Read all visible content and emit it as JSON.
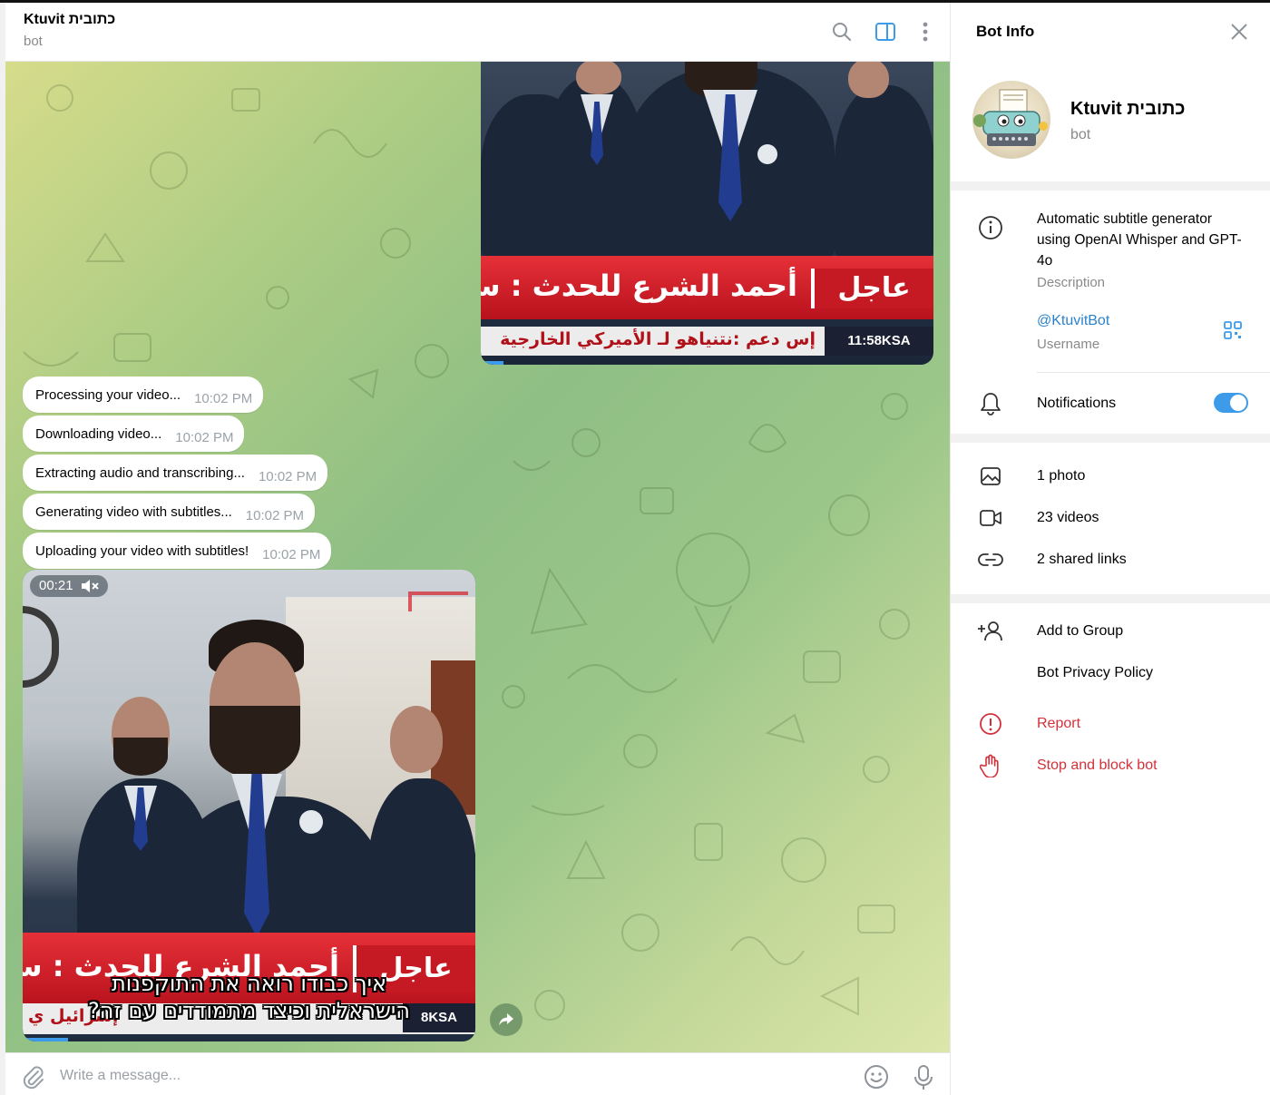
{
  "chat": {
    "title": "Ktuvit כתובית",
    "subtitle": "bot",
    "messages": [
      {
        "text": "Processing your video...",
        "time": "10:02 PM"
      },
      {
        "text": "Downloading video...",
        "time": "10:02 PM"
      },
      {
        "text": "Extracting audio and transcribing...",
        "time": "10:02 PM"
      },
      {
        "text": "Generating video with subtitles...",
        "time": "10:02 PM"
      },
      {
        "text": "Uploading your video with subtitles!",
        "time": "10:02 PM"
      }
    ],
    "video_top": {
      "banner_text": "أحمد الشرع للحدث : سوريا",
      "breaking_label": "عاجل",
      "ticker_text": "إس دعم :نتنياهو لـ الأميركي الخارجية",
      "clock": "11:58KSA",
      "progress": 0.05
    },
    "video_main": {
      "duration": "00:21",
      "banner_text": "أحمد الشرع للحدث : سوريا",
      "breaking_label": "عاجل",
      "subtitle_line1": "איך כבודו רואה את התוקפנות",
      "subtitle_line2": "הישראלית וכיצד מתמודדים עם זה?",
      "ticker_text": "إسرائيل ي",
      "clock": "8KSA",
      "progress": 0.1
    },
    "composer": {
      "placeholder": "Write a message..."
    }
  },
  "info_panel": {
    "title": "Bot Info",
    "name": "Ktuvit כתובית",
    "subtitle": "bot",
    "description": "Automatic subtitle generator using OpenAI Whisper and GPT-4o",
    "description_caption": "Description",
    "username": "@KtuvitBot",
    "username_caption": "Username",
    "notifications_label": "Notifications",
    "notifications_on": true,
    "media": {
      "photos": "1 photo",
      "videos": "23 videos",
      "links": "2 shared links"
    },
    "actions": {
      "add_to_group": "Add to Group",
      "privacy_policy": "Bot Privacy Policy",
      "report": "Report",
      "stop_block": "Stop and block bot"
    }
  },
  "colors": {
    "accent": "#3d9be9",
    "danger": "#d3313a",
    "link": "#2b82cc"
  },
  "icons": [
    "search-icon",
    "sidebar-toggle-icon",
    "more-vertical-icon",
    "close-icon",
    "info-icon",
    "qr-code-icon",
    "bell-icon",
    "photo-icon",
    "video-icon",
    "link-icon",
    "add-user-icon",
    "report-icon",
    "hand-stop-icon",
    "paperclip-icon",
    "emoji-icon",
    "microphone-icon",
    "forward-icon",
    "muted-speaker-icon"
  ]
}
